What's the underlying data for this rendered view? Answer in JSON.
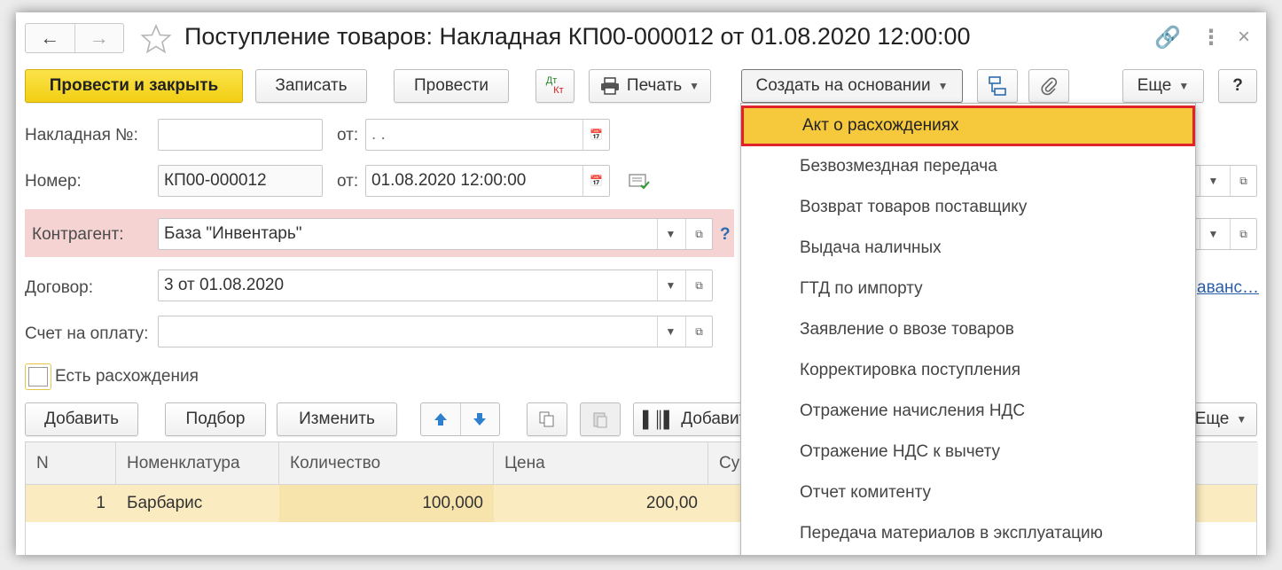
{
  "window": {
    "title": "Поступление товаров: Накладная КП00-000012 от 01.08.2020 12:00:00",
    "nav_back": "←",
    "nav_forward": "→",
    "icon_link": "🔗",
    "icon_more": "⋮",
    "icon_close": "×"
  },
  "toolbar": {
    "post_close": "Провести и закрыть",
    "save": "Записать",
    "post": "Провести",
    "dtkt_top": "Дт",
    "dtkt_bottom": "Кт",
    "print": "Печать",
    "create_based": "Создать на основании",
    "more": "Еще",
    "help": "?"
  },
  "form": {
    "invoice_label": "Накладная №:",
    "invoice_value": "",
    "from1_label": "от:",
    "from1_value": " .  .",
    "number_label": "Номер:",
    "number_value": "КП00-000012",
    "from2_label": "от:",
    "from2_value": "01.08.2020 12:00:00",
    "counterparty_label": "Контрагент:",
    "counterparty_value": "База \"Инвентарь\"",
    "counterparty_help": "?",
    "contract_label": "Договор:",
    "contract_value": "3 от 01.08.2020",
    "pay_account_label": "Счет на оплату:",
    "pay_account_value": "",
    "discrepancy_label": "Есть расхождения",
    "discrepancy_checked": false,
    "advance_link": "аванс…"
  },
  "table_toolbar": {
    "add": "Добавить",
    "select": "Подбор",
    "edit": "Изменить",
    "add_barcode": "Добавит",
    "more": "Еще"
  },
  "table": {
    "columns": [
      "N",
      "Номенклатура",
      "Количество",
      "Цена",
      "Су"
    ],
    "rows": [
      {
        "n": "1",
        "item": "Барбарис",
        "qty": "100,000",
        "price": "200,00"
      }
    ]
  },
  "dropdown": {
    "items": [
      "Акт о расхождениях",
      "Безвозмездная передача",
      "Возврат товаров поставщику",
      "Выдача наличных",
      "ГТД по импорту",
      "Заявление о ввозе товаров",
      "Корректировка поступления",
      "Отражение начисления НДС",
      "Отражение НДС к вычету",
      "Отчет комитенту",
      "Передача материалов в эксплуатацию"
    ],
    "highlighted_index": 0,
    "highlight_color": "#f6c93c",
    "highlight_border": "#e0222a"
  },
  "colors": {
    "primary_button": "#f2cf14",
    "counterparty_band": "#f6d3d3",
    "selected_row": "#faebc0"
  }
}
